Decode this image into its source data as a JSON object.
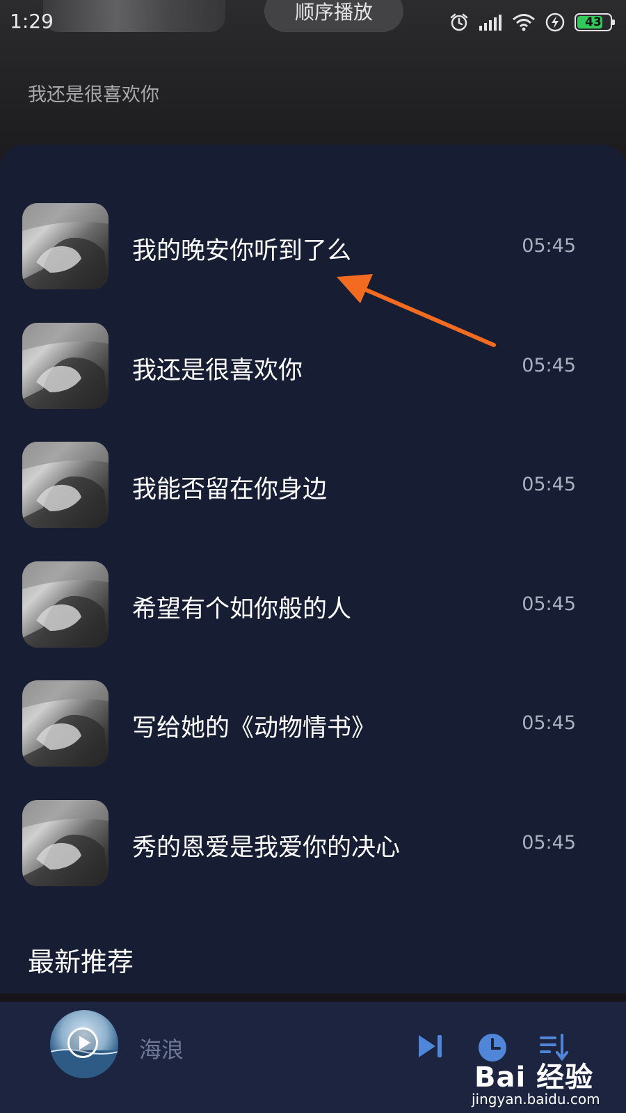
{
  "status_bar": {
    "time": "1:29",
    "battery": "43"
  },
  "header": {
    "play_mode": "顺序播放",
    "subtitle": "我还是很喜欢你"
  },
  "songs": [
    {
      "title": "我的晚安你听到了么",
      "duration": "05:45"
    },
    {
      "title": "我还是很喜欢你",
      "duration": "05:45"
    },
    {
      "title": "我能否留在你身边",
      "duration": "05:45"
    },
    {
      "title": "希望有个如你般的人",
      "duration": "05:45"
    },
    {
      "title": "写给她的《动物情书》",
      "duration": "05:45"
    },
    {
      "title": "秀的恩爱是我爱你的决心",
      "duration": "05:45"
    }
  ],
  "section": {
    "title": "最新推荐"
  },
  "player": {
    "now_playing": "海浪",
    "icons": [
      "play-icon",
      "next-track-icon",
      "timer-icon",
      "playlist-icon"
    ]
  },
  "watermark": {
    "brand": "Bai 经验",
    "url": "jingyan.baidu.com"
  },
  "colors": {
    "sheet": "#171e33",
    "player": "#1c2440",
    "annotation": "#f26b21"
  }
}
